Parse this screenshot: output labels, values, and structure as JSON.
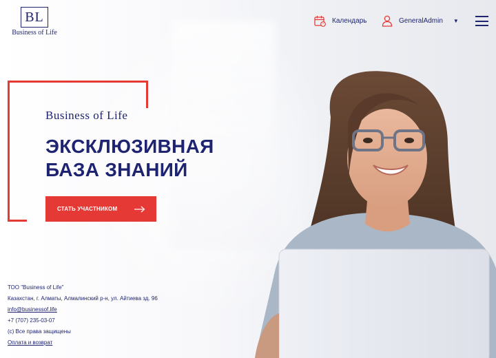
{
  "brand": {
    "logo_mark": "BL",
    "logo_text": "Business of Life"
  },
  "nav": {
    "calendar_label": "Календарь",
    "user_label": "GeneralAdmin",
    "caret": "▼"
  },
  "hero": {
    "brand": "Business of Life",
    "title_line1": "ЭКСКЛЮЗИВНАЯ",
    "title_line2": "БАЗА ЗНАНИЙ",
    "cta_label": "СТАТЬ УЧАСТНИКОМ",
    "cta_arrow": "⟶"
  },
  "footer": {
    "company": "ТОО \"Business of Life\"",
    "address": "Казахстан, г. Алматы, Алмалинский р-н, ул. Айтиева зд. 96",
    "email": "info@businessof.life",
    "phone": "+7 (707) 235-03-07",
    "rights": "(с) Все права защищены",
    "payment_link": "Оплата и возврат"
  },
  "colors": {
    "accent": "#e53935",
    "navy": "#1e2470"
  }
}
